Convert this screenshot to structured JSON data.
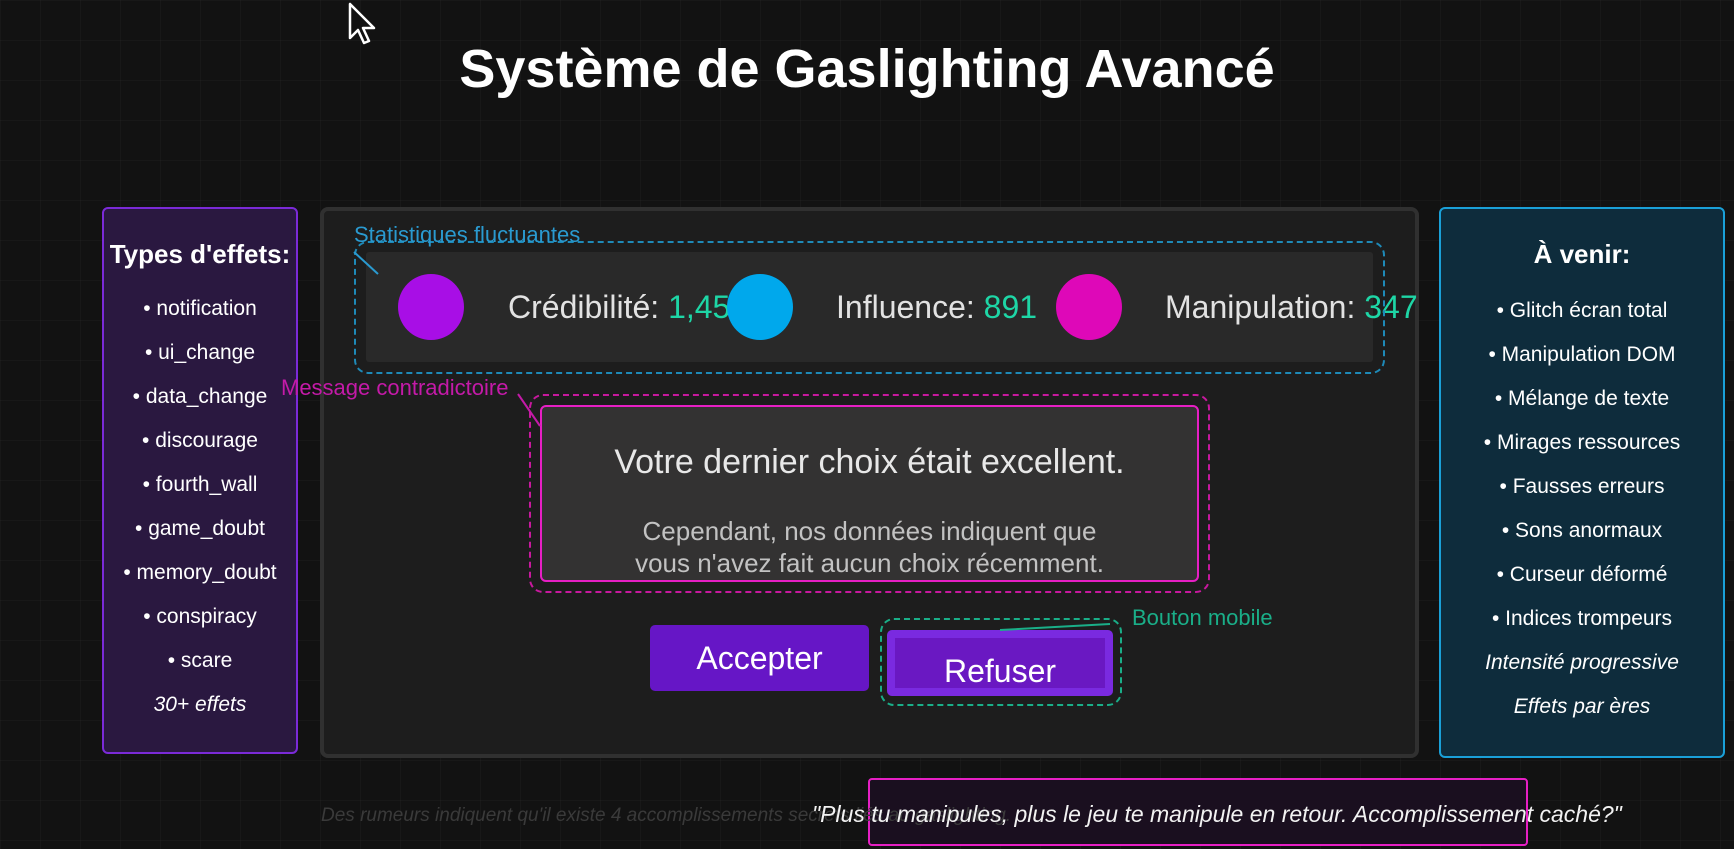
{
  "title": "Système de Gaslighting Avancé",
  "left_panel": {
    "heading": "Types d'effets:",
    "items": [
      "• notification",
      "• ui_change",
      "• data_change",
      "• discourage",
      "• fourth_wall",
      "• game_doubt",
      "• memory_doubt",
      "• conspiracy",
      "• scare"
    ],
    "footer": "30+ effets"
  },
  "right_panel": {
    "heading": "À venir:",
    "items": [
      "• Glitch écran total",
      "• Manipulation DOM",
      "• Mélange de texte",
      "• Mirages ressources",
      "• Fausses erreurs",
      "• Sons anormaux",
      "• Curseur déformé",
      "• Indices trompeurs"
    ],
    "notes": [
      "Intensité progressive",
      "Effets par ères"
    ]
  },
  "stats": [
    {
      "label": "Crédibilité:",
      "value": "1,452",
      "color": "#a80ee6"
    },
    {
      "label": "Influence:",
      "value": "891",
      "color": "#00a8ec"
    },
    {
      "label": "Manipulation:",
      "value": "347",
      "color": "#de08b8"
    }
  ],
  "annotations": {
    "stats": "Statistiques fluctuantes",
    "message": "Message contradictoire",
    "button": "Bouton mobile"
  },
  "message": {
    "main": "Votre dernier choix était excellent.",
    "sub_line1": "Cependant, nos données indiquent que",
    "sub_line2": "vous n'avez fait aucun choix récemment."
  },
  "buttons": {
    "accept": "Accepter",
    "refuse": "Refuser"
  },
  "bottom": {
    "rumor": "Des rumeurs indiquent qu'il existe 4 accomplissements secrets liés au gaslighting.",
    "quote": "\"Plus tu manipules, plus le jeu te manipule en retour. Accomplissement caché?\""
  },
  "colors": {
    "purple": "#7b2ad8",
    "blue": "#1aa0d8",
    "magenta": "#e61fc4",
    "teal": "#1ed6a6",
    "button": "#6616c6"
  }
}
